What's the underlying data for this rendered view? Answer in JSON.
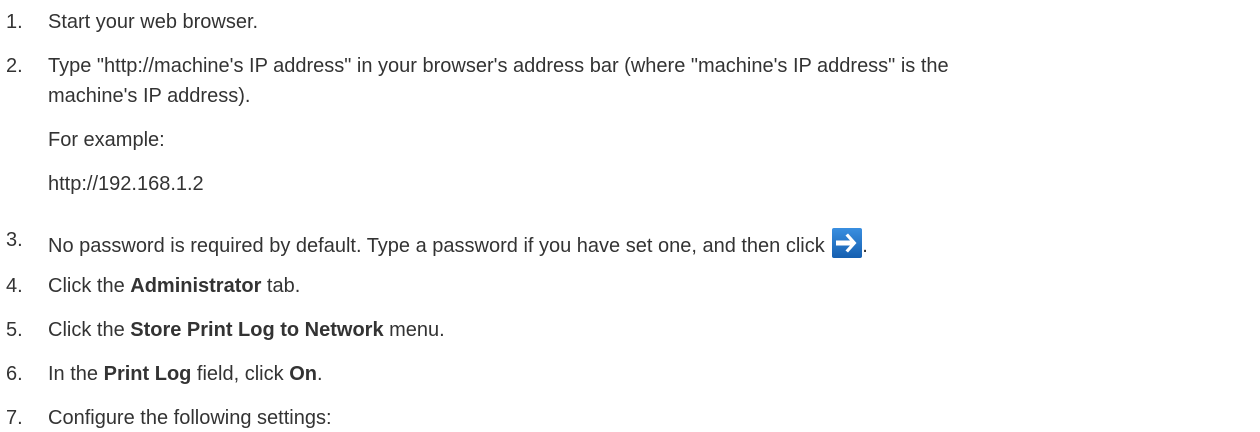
{
  "steps": [
    {
      "num": "1.",
      "text": "Start your web browser."
    },
    {
      "num": "2.",
      "text_line1": "Type \"http://machine's IP address\" in your browser's address bar (where \"machine's IP address\" is the",
      "text_line2": "machine's IP address)."
    },
    {
      "num": "3.",
      "text": "No password is required by default. Type a password if you have set one, and then click ",
      "after": "."
    },
    {
      "num": "4.",
      "pre": "Click the ",
      "bold": "Administrator",
      "post": " tab."
    },
    {
      "num": "5.",
      "pre": "Click the ",
      "bold": "Store Print Log to Network",
      "post": " menu."
    },
    {
      "num": "6.",
      "pre": "In the ",
      "bold": "Print Log",
      "mid": " field, click ",
      "bold2": "On",
      "post": "."
    },
    {
      "num": "7.",
      "text": "Configure the following settings:"
    }
  ],
  "example": {
    "label": "For example:",
    "url": "http://192.168.1.2"
  },
  "icons": {
    "login_arrow": "arrow-right-icon",
    "login_arrow_bg": "#1f6fc4"
  }
}
